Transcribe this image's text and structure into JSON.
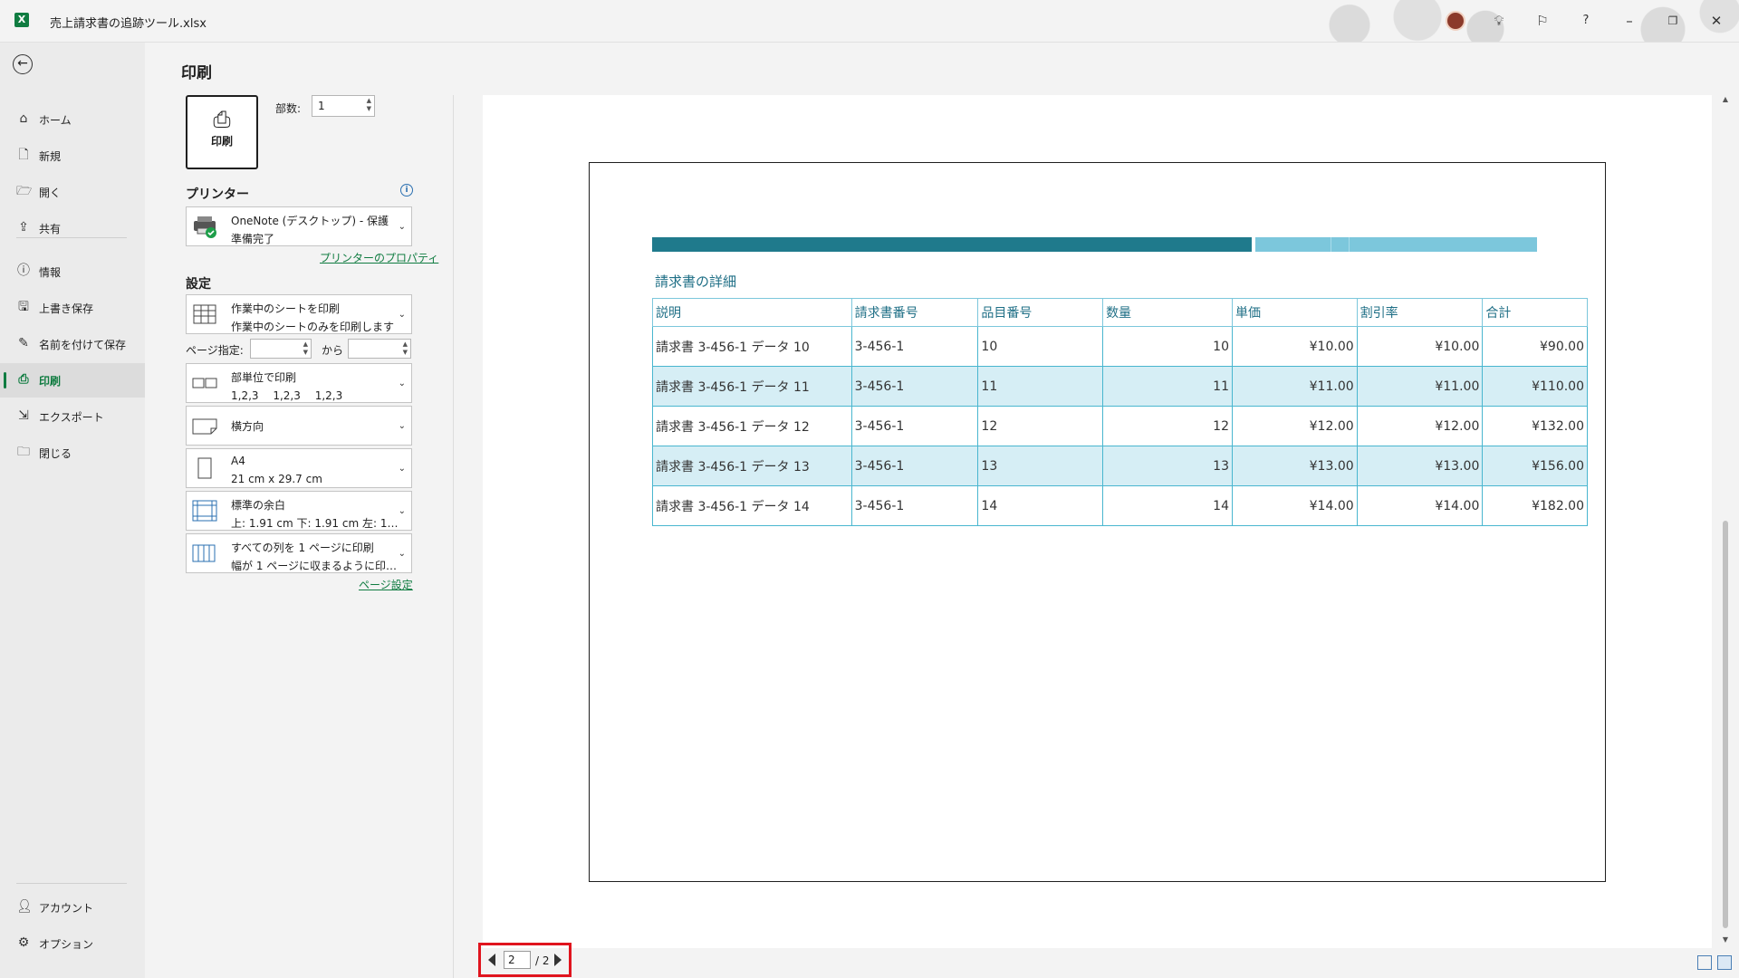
{
  "window": {
    "title": "売上請求書の追跡ツール.xlsx",
    "app_logo": "X"
  },
  "nav": {
    "items": [
      {
        "label": "ホーム",
        "icon": "home-icon"
      },
      {
        "label": "新規",
        "icon": "new-file-icon"
      },
      {
        "label": "開く",
        "icon": "open-folder-icon"
      },
      {
        "label": "共有",
        "icon": "share-icon"
      },
      {
        "label": "情報",
        "icon": "info-icon"
      },
      {
        "label": "上書き保存",
        "icon": "save-icon"
      },
      {
        "label": "名前を付けて保存",
        "icon": "save-as-icon"
      },
      {
        "label": "印刷",
        "icon": "printer-icon",
        "active": true
      },
      {
        "label": "エクスポート",
        "icon": "export-icon"
      },
      {
        "label": "閉じる",
        "icon": "close-folder-icon"
      }
    ],
    "bottom": [
      {
        "label": "アカウント",
        "icon": "account-icon"
      },
      {
        "label": "オプション",
        "icon": "options-icon"
      }
    ]
  },
  "print": {
    "title": "印刷",
    "button_label": "印刷",
    "copies_label": "部数:",
    "copies_value": "1",
    "printer_heading": "プリンター",
    "printer_name": "OneNote (デスクトップ) - 保護",
    "printer_status": "準備完了",
    "printer_properties": "プリンターのプロパティ",
    "settings_heading": "設定",
    "what_to_print": {
      "l1": "作業中のシートを印刷",
      "l2": "作業中のシートのみを印刷します"
    },
    "pages_label": "ページ指定:",
    "pages_to": "から",
    "collate": {
      "l1": "部単位で印刷",
      "l2": "1,2,3　 1,2,3　 1,2,3"
    },
    "orientation": "横方向",
    "paper": {
      "l1": "A4",
      "l2": "21 cm x 29.7 cm"
    },
    "margins": {
      "l1": "標準の余白",
      "l2": "上: 1.91 cm 下: 1.91 cm 左: 1…"
    },
    "scaling": {
      "l1": "すべての列を 1 ページに印刷",
      "l2": "幅が 1 ページに収まるように印刷イ…"
    },
    "page_setup": "ページ設定"
  },
  "preview": {
    "heading": "請求書の詳細",
    "columns": [
      "説明",
      "請求書番号",
      "品目番号",
      "数量",
      "単価",
      "割引率",
      "合計"
    ],
    "rows": [
      [
        "請求書 3-456-1 データ 10",
        "3-456-1",
        "10",
        "10",
        "¥10.00",
        "¥10.00",
        "¥90.00"
      ],
      [
        "請求書 3-456-1 データ 11",
        "3-456-1",
        "11",
        "11",
        "¥11.00",
        "¥11.00",
        "¥110.00"
      ],
      [
        "請求書 3-456-1 データ 12",
        "3-456-1",
        "12",
        "12",
        "¥12.00",
        "¥12.00",
        "¥132.00"
      ],
      [
        "請求書 3-456-1 データ 13",
        "3-456-1",
        "13",
        "13",
        "¥13.00",
        "¥13.00",
        "¥156.00"
      ],
      [
        "請求書 3-456-1 データ 14",
        "3-456-1",
        "14",
        "14",
        "¥14.00",
        "¥14.00",
        "¥182.00"
      ]
    ],
    "page_current": "2",
    "page_total": "/ 2"
  },
  "colors": {
    "accent": "#107c41",
    "table_dark": "#1f7a8c",
    "table_light": "#7cc7dc",
    "highlight": "#e0141e"
  }
}
